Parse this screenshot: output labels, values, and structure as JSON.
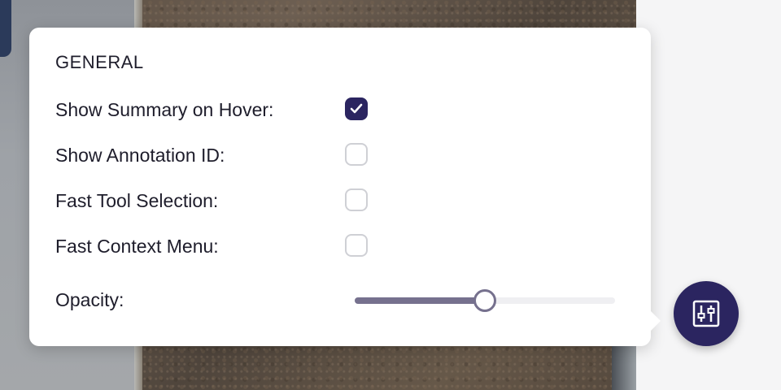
{
  "colors": {
    "accent": "#2b2560",
    "slider": "#76718e",
    "checkbox_border": "#cfd0d5",
    "text": "#1e1d2b"
  },
  "settings_panel": {
    "section_title": "GENERAL",
    "options": [
      {
        "label": "Show Summary on Hover:",
        "checked": true
      },
      {
        "label": "Show Annotation ID:",
        "checked": false
      },
      {
        "label": "Fast Tool Selection:",
        "checked": false
      },
      {
        "label": "Fast Context Menu:",
        "checked": false
      }
    ],
    "opacity": {
      "label": "Opacity:",
      "value": 0.5
    }
  },
  "settings_button": {
    "icon": "sliders-icon"
  }
}
